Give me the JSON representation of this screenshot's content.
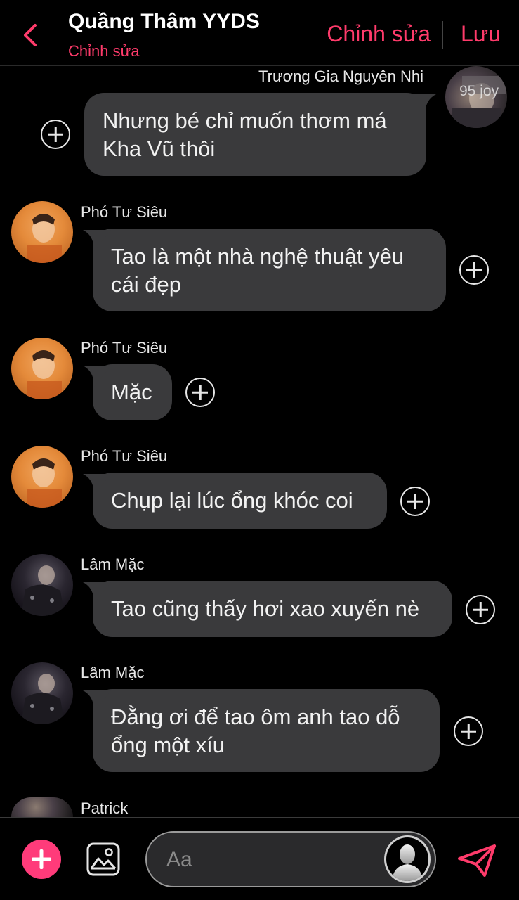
{
  "header": {
    "title": "Quầng Thâm YYDS",
    "subtitle": "Chỉnh sửa",
    "edit_label": "Chỉnh sửa",
    "save_label": "Lưu"
  },
  "messages": [
    {
      "sender": "Trương Gia Nguyên Nhi",
      "side": "right",
      "text_lines": [
        "Nhưng bé chỉ muốn thơm má",
        "Kha Vũ thôi"
      ],
      "avatar_watermark": "95 joy"
    },
    {
      "sender": "Phó Tư Siêu",
      "side": "left",
      "text_lines": [
        "Tao là một nhà nghệ thuật yêu",
        "cái đẹp"
      ]
    },
    {
      "sender": "Phó Tư Siêu",
      "side": "left",
      "text_lines": [
        "Mặc"
      ]
    },
    {
      "sender": "Phó Tư Siêu",
      "side": "left",
      "text_lines": [
        "Chụp lại lúc ổng khóc coi"
      ]
    },
    {
      "sender": "Lâm Mặc",
      "side": "left",
      "text_lines": [
        "Tao cũng thấy hơi xao xuyến nè"
      ]
    },
    {
      "sender": "Lâm Mặc",
      "side": "left",
      "text_lines": [
        "Đằng ơi để tao ôm anh tao dỗ",
        "ổng một xíu"
      ]
    },
    {
      "sender": "Patrick",
      "side": "left",
      "text_lines": []
    }
  ],
  "composer": {
    "placeholder": "Aa"
  },
  "colors": {
    "accent": "#ff3b6b",
    "bubble": "#3a3a3c",
    "background": "#000000"
  },
  "icons": [
    "back-chevron-icon",
    "plus-circle-icon",
    "image-icon",
    "persona-icon",
    "send-icon"
  ]
}
